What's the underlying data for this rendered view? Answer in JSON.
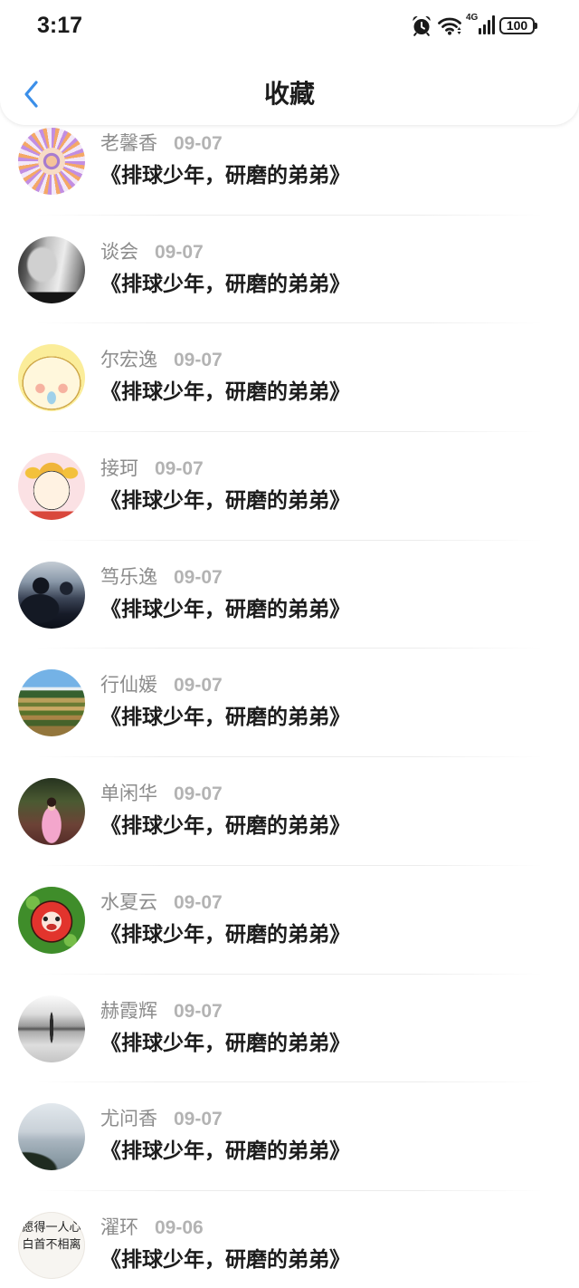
{
  "status_bar": {
    "time": "3:17",
    "network_type": "4G",
    "battery_level": "100",
    "icons": [
      "alarm-icon",
      "wifi-icon",
      "signal-icon",
      "battery-icon"
    ]
  },
  "header": {
    "title": "收藏",
    "back_icon": "chevron-left-icon"
  },
  "items": [
    {
      "name": "老馨香",
      "date": "09-07",
      "title": "《排球少年，研磨的弟弟》"
    },
    {
      "name": "谈会",
      "date": "09-07",
      "title": "《排球少年，研磨的弟弟》"
    },
    {
      "name": "尔宏逸",
      "date": "09-07",
      "title": "《排球少年，研磨的弟弟》"
    },
    {
      "name": "接珂",
      "date": "09-07",
      "title": "《排球少年，研磨的弟弟》"
    },
    {
      "name": "笃乐逸",
      "date": "09-07",
      "title": "《排球少年，研磨的弟弟》"
    },
    {
      "name": "行仙媛",
      "date": "09-07",
      "title": "《排球少年，研磨的弟弟》"
    },
    {
      "name": "单闲华",
      "date": "09-07",
      "title": "《排球少年，研磨的弟弟》"
    },
    {
      "name": "水夏云",
      "date": "09-07",
      "title": "《排球少年，研磨的弟弟》"
    },
    {
      "name": "赫霞辉",
      "date": "09-07",
      "title": "《排球少年，研磨的弟弟》"
    },
    {
      "name": "尤问香",
      "date": "09-07",
      "title": "《排球少年，研磨的弟弟》"
    },
    {
      "name": "濯环",
      "date": "09-06",
      "title": "《排球少年，研磨的弟弟》",
      "avatar_text": [
        "愿得一人心",
        "白首不相离"
      ]
    }
  ],
  "colors": {
    "accent": "#3b8fe9",
    "background": "#ffffff",
    "title_text": "#1c1c1c",
    "name_text": "#8c8c8c",
    "date_text": "#b3b3b3"
  }
}
